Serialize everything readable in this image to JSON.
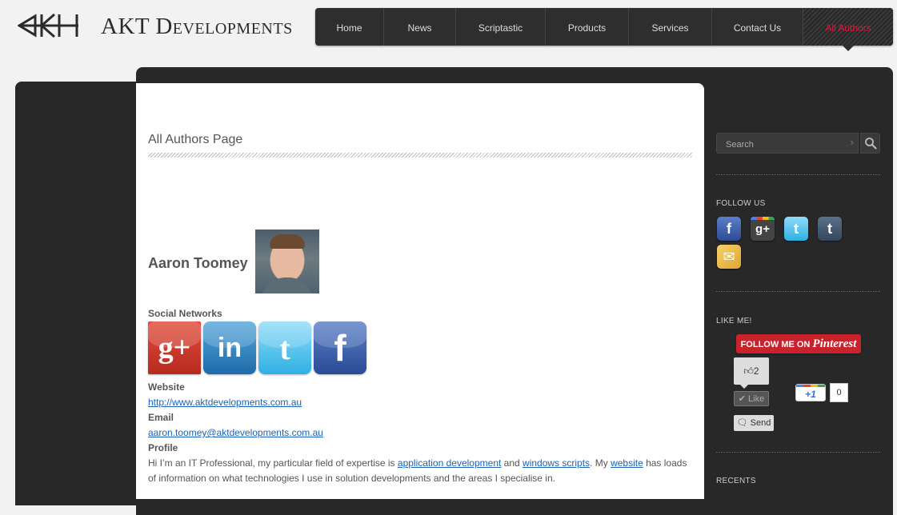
{
  "site": {
    "logo_text": "AKT Developments"
  },
  "nav": {
    "items": [
      {
        "label": "Home"
      },
      {
        "label": "News"
      },
      {
        "label": "Scriptastic"
      },
      {
        "label": "Products"
      },
      {
        "label": "Services"
      },
      {
        "label": "Contact Us"
      },
      {
        "label": "All Authors"
      }
    ],
    "active_index": 6,
    "active_color": "#e0193c"
  },
  "main": {
    "page_title": "All Authors Page",
    "author": {
      "name": "Aaron Toomey",
      "social_heading": "Social Networks",
      "social_icons": [
        "google-plus-icon",
        "linkedin-icon",
        "twitter-icon",
        "facebook-icon"
      ],
      "website_label": "Website",
      "website_url": "http://www.aktdevelopments.com.au",
      "email_label": "Email",
      "email": "aaron.toomey@aktdevelopments.com.au",
      "profile_label": "Profile",
      "profile": {
        "t1": "Hi I’m an IT Professional, my particular field of expertise is ",
        "link1": "application development",
        "t2": " and ",
        "link2": "windows scripts",
        "t3": ". My ",
        "link3": "website",
        "t4": " has loads of information on what technologies I use in solution developments and the areas I specialise in."
      }
    }
  },
  "sidebar": {
    "search_placeholder": "Search",
    "follow_heading": "FOLLOW US",
    "follow_icons": [
      "facebook-icon",
      "google-plus-icon",
      "twitter-icon",
      "tumblr-icon",
      "rss-icon"
    ],
    "like_heading": "LIKE ME!",
    "pinterest": {
      "prefix": "FOLLOW ME ON",
      "brand": "Pinterest"
    },
    "fb_like_count": "2",
    "fb_like_label": "Like",
    "fb_send_label": "Send",
    "gplus_label": "+1",
    "gplus_count": "0",
    "recents_heading": "RECENTS"
  }
}
